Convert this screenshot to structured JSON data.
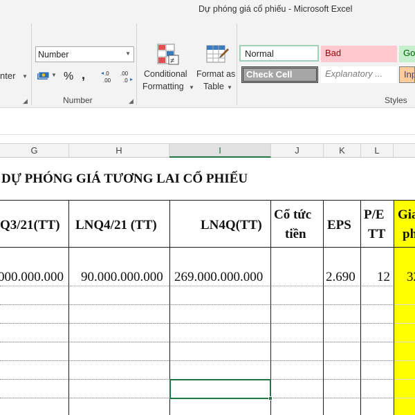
{
  "window": {
    "title": "Dự phóng giá cổ phiếu - Microsoft Excel"
  },
  "ribbon": {
    "alignment": {
      "wrap_partial": "nter"
    },
    "number": {
      "format_value": "Number",
      "currency_symbol": "$",
      "percent_symbol": "%",
      "comma_symbol": ",",
      "increase_decimal": "←.0\n.00",
      "decrease_decimal": ".00\n→.0",
      "group_label": "Number"
    },
    "styles": {
      "conditional_formatting_line1": "Conditional",
      "conditional_formatting_line2": "Formatting",
      "format_as_table_line1": "Format as",
      "format_as_table_line2": "Table",
      "group_label": "Styles",
      "cells": [
        {
          "label": "Normal"
        },
        {
          "label": "Bad"
        },
        {
          "label": "Go"
        },
        {
          "label": "Check Cell"
        },
        {
          "label": "Explanatory ..."
        },
        {
          "label": "Inp"
        }
      ]
    }
  },
  "columns": [
    "G",
    "H",
    "I",
    "J",
    "K",
    "L"
  ],
  "sheet": {
    "title": "DỰ PHÓNG GIÁ TƯƠNG LAI CỔ PHIẾU",
    "headers": {
      "g": "Q3/21(TT)",
      "h": "LNQ4/21 (TT)",
      "i": "LN4Q(TT)",
      "j_line1": "Cổ tức",
      "j_line2": "tiền",
      "k": "EPS",
      "l_line1": "P/E",
      "l_line2": "TT",
      "m_line1": "Gia",
      "m_line2": "ph"
    },
    "row1": {
      "g": "000.000.000",
      "h": "90.000.000.000",
      "i": "269.000.000.000",
      "j": "",
      "k": "2.690",
      "l": "12",
      "m": "32"
    }
  }
}
